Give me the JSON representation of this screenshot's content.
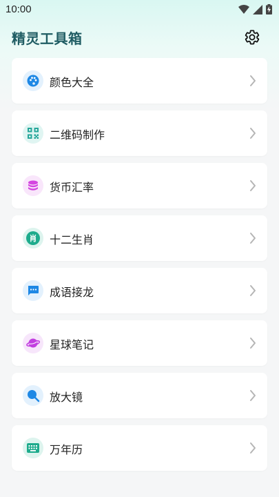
{
  "status": {
    "time": "10:00"
  },
  "header": {
    "title": "精灵工具箱"
  },
  "items": [
    {
      "label": "颜色大全",
      "icon": "palette-icon",
      "color": "#1e88e5",
      "bg": "#e3f1fd"
    },
    {
      "label": "二维码制作",
      "icon": "qr-code-icon",
      "color": "#26a69a",
      "bg": "#e0f5f2"
    },
    {
      "label": "货币汇率",
      "icon": "coin-stack-icon",
      "color": "#d446e0",
      "bg": "#f9e6fb"
    },
    {
      "label": "十二生肖",
      "icon": "zodiac-icon",
      "color": "#1dab8c",
      "bg": "#ddf4ee"
    },
    {
      "label": "成语接龙",
      "icon": "chat-bubble-icon",
      "color": "#1e88e5",
      "bg": "#e3f1fd"
    },
    {
      "label": "星球笔记",
      "icon": "planet-icon",
      "color": "#c23fe0",
      "bg": "#f7e6fb"
    },
    {
      "label": "放大镜",
      "icon": "magnifier-icon",
      "color": "#1e88e5",
      "bg": "#e3f1fd"
    },
    {
      "label": "万年历",
      "icon": "keyboard-calendar-icon",
      "color": "#1dab8c",
      "bg": "#ddf4ee"
    }
  ],
  "zodiac_glyph": "肖"
}
